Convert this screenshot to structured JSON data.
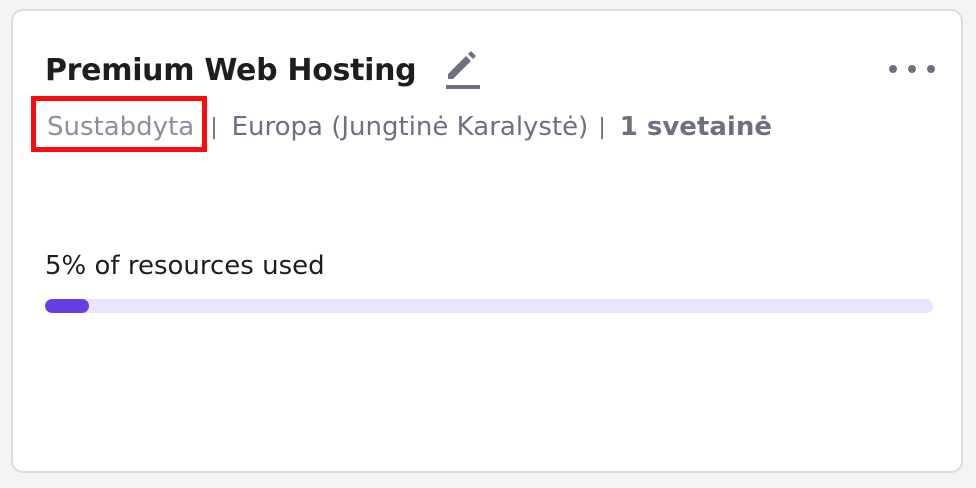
{
  "card": {
    "title": "Premium Web Hosting",
    "status": "Sustabdyta",
    "separator": "|",
    "region": "Europa (Jungtinė Karalystė)",
    "sites": "1 svetainė",
    "usage_label": "5% of resources used",
    "usage_percent": 5
  },
  "icons": {
    "edit": "pencil-icon",
    "more": "more-horizontal-icon"
  },
  "colors": {
    "progress_fill": "#673de6",
    "progress_track": "#ebe4ff",
    "highlight": "#ff0a0a"
  }
}
